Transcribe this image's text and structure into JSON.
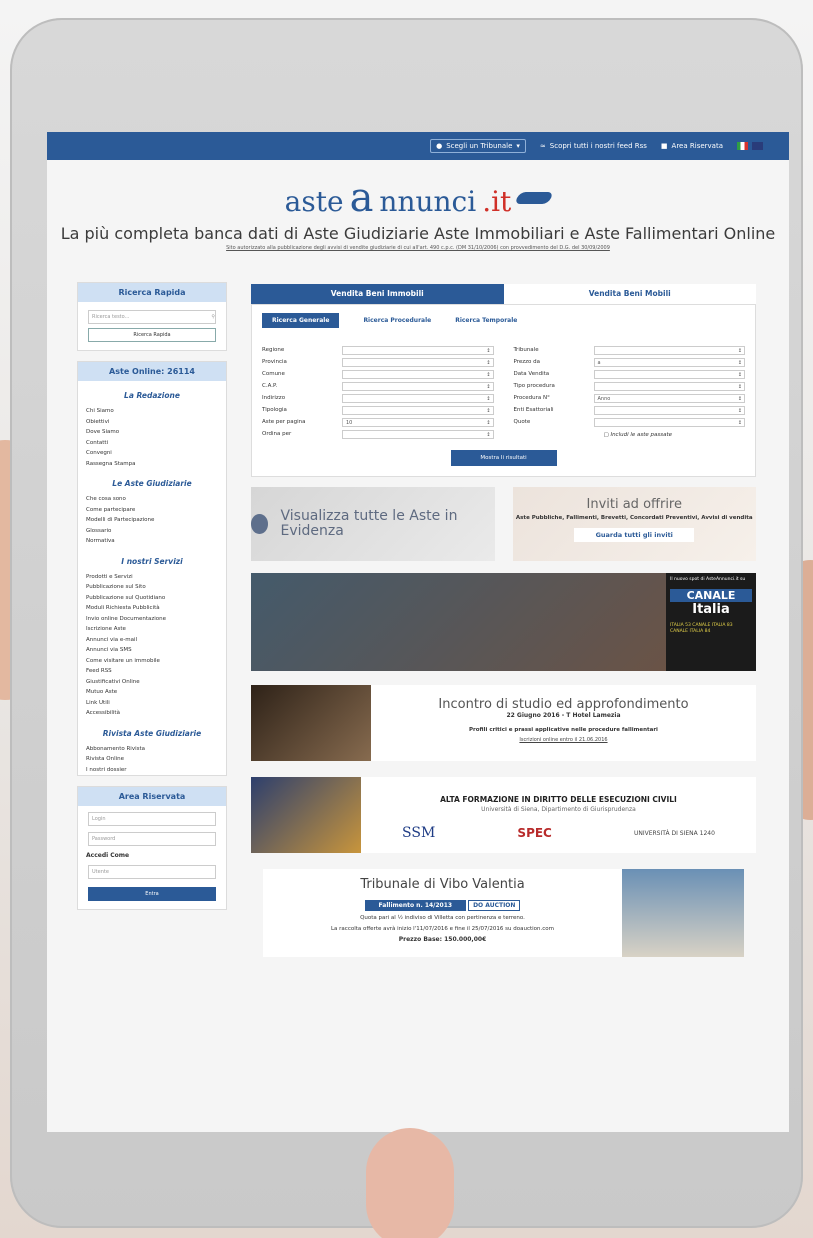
{
  "topbar": {
    "tribunale": "Scegli un Tribunale",
    "feed": "Scopri tutti i nostri feed Rss",
    "area": "Area Riservata"
  },
  "logo": {
    "prefix": "aste",
    "big_letter": "a",
    "suffix": "nnunci",
    "tld": ".it"
  },
  "tagline": "La più completa banca dati di Aste Giudiziarie Aste Immobiliari e Aste Fallimentari Online",
  "authorized": "Sito autorizzato alla pubblicazione degli avvisi di vendite giudiziarie di cui all'art. 490 c.p.c. (DM 31/10/2006) con provvedimento del D.G. del 30/09/2009",
  "quick_search": {
    "title": "Ricerca Rapida",
    "placeholder": "Ricerca testo...",
    "button": "Ricerca Rapida"
  },
  "online": {
    "title": "Aste Online: 26114",
    "sections": [
      {
        "heading": "La Redazione",
        "items": [
          "Chi Siamo",
          "Obiettivi",
          "Dove Siamo",
          "Contatti",
          "Convegni",
          "Rassegna Stampa"
        ]
      },
      {
        "heading": "Le Aste Giudiziarie",
        "items": [
          "Che cosa sono",
          "Come partecipare",
          "Modelli di Partecipazione",
          "Glossario",
          "Normativa"
        ]
      },
      {
        "heading": "I nostri Servizi",
        "items": [
          "Prodotti e Servizi",
          "Pubblicazione sul Sito",
          "Pubblicazione sul Quotidiano",
          "Moduli Richiesta Pubblicità",
          "Invio online Documentazione",
          "Iscrizione Aste",
          "Annunci via e-mail",
          "Annunci via SMS",
          "Come visitare un immobile",
          "Feed RSS",
          "Giustificativi Online",
          "Mutuo Aste",
          "Link Utili",
          "Accessibilità"
        ]
      },
      {
        "heading": "Rivista Aste Giudiziarie",
        "items": [
          "Abbonamento Rivista",
          "Rivista Online",
          "I nostri dossier"
        ]
      }
    ]
  },
  "reserved": {
    "title": "Area Riservata",
    "login_placeholder": "Login",
    "password_placeholder": "Password",
    "access_label": "Accedi Come",
    "access_value": "Utente",
    "enter": "Entra"
  },
  "tabs": {
    "immobili": "Vendita Beni Immobili",
    "mobili": "Vendita Beni Mobili"
  },
  "subtabs": {
    "generale": "Ricerca Generale",
    "procedurale": "Ricerca Procedurale",
    "temporale": "Ricerca Temporale"
  },
  "form": {
    "left": [
      {
        "label": "Regione",
        "value": ""
      },
      {
        "label": "Provincia",
        "value": ""
      },
      {
        "label": "Comune",
        "value": ""
      },
      {
        "label": "C.A.P.",
        "value": ""
      },
      {
        "label": "Indirizzo",
        "value": ""
      },
      {
        "label": "Tipologia",
        "value": ""
      },
      {
        "label": "Aste per pagina",
        "value": "10"
      },
      {
        "label": "Ordina per",
        "value": ""
      }
    ],
    "right": [
      {
        "label": "Tribunale",
        "value": ""
      },
      {
        "label": "Prezzo da",
        "value": "a"
      },
      {
        "label": "Data Vendita",
        "value": ""
      },
      {
        "label": "Tipo procedura",
        "value": ""
      },
      {
        "label": "Procedura N°",
        "value": "Anno"
      },
      {
        "label": "Enti Esattoriali",
        "value": ""
      },
      {
        "label": "Quote",
        "value": ""
      }
    ],
    "include_past": "Includi le aste passate",
    "show_results": "Mostra Ii risultati"
  },
  "promo": {
    "evidenza": "Visualizza tutte le Aste in Evidenza",
    "inviti_title": "Inviti ad offrire",
    "inviti_sub": "Aste Pubbliche, Fallimenti, Brevetti, Concordati Preventivi, Avvisi di vendita",
    "inviti_btn": "Guarda tutti gli inviti"
  },
  "canale": {
    "intro": "Il nuovo spot di AsteAnnunci.it su",
    "logo_top": "CANALE",
    "logo_bottom": "Italia",
    "channels": "ITALIA 53 CANALE ITALIA 83 CANALE ITALIA 84"
  },
  "incontro": {
    "title": "Incontro di studio ed approfondimento",
    "date": "22 Giugno 2016 - T Hotel Lamezia",
    "subtitle": "Profili critici e prassi applicative nelle procedure fallimentari",
    "link": "Iscrizioni online entro il 21.06.2016"
  },
  "alta": {
    "title": "ALTA FORMAZIONE IN DIRITTO DELLE ESECUZIONI CIVILI",
    "subtitle": "Università di Siena, Dipartimento di Giurisprudenza",
    "logo1": "SSM",
    "logo2": "SPEC",
    "logo3": "UNIVERSITÀ DI SIENA 1240"
  },
  "vibo": {
    "title": "Tribunale di Vibo Valentia",
    "badge": "Fallimento n. 14/2013",
    "badge_brand": "DO AUCTION",
    "desc1": "Quota pari al ½ indiviso di Villetta con pertinenza e terreno.",
    "desc2": "La raccolta offerte avrà inizio l'11/07/2016 e fine il 25/07/2016 su doauction.com",
    "price": "Prezzo Base: 150.000,00€"
  },
  "colors": {
    "brand_blue": "#2b5a97",
    "accent_red": "#d03028",
    "light_blue": "#cfe0f3"
  }
}
